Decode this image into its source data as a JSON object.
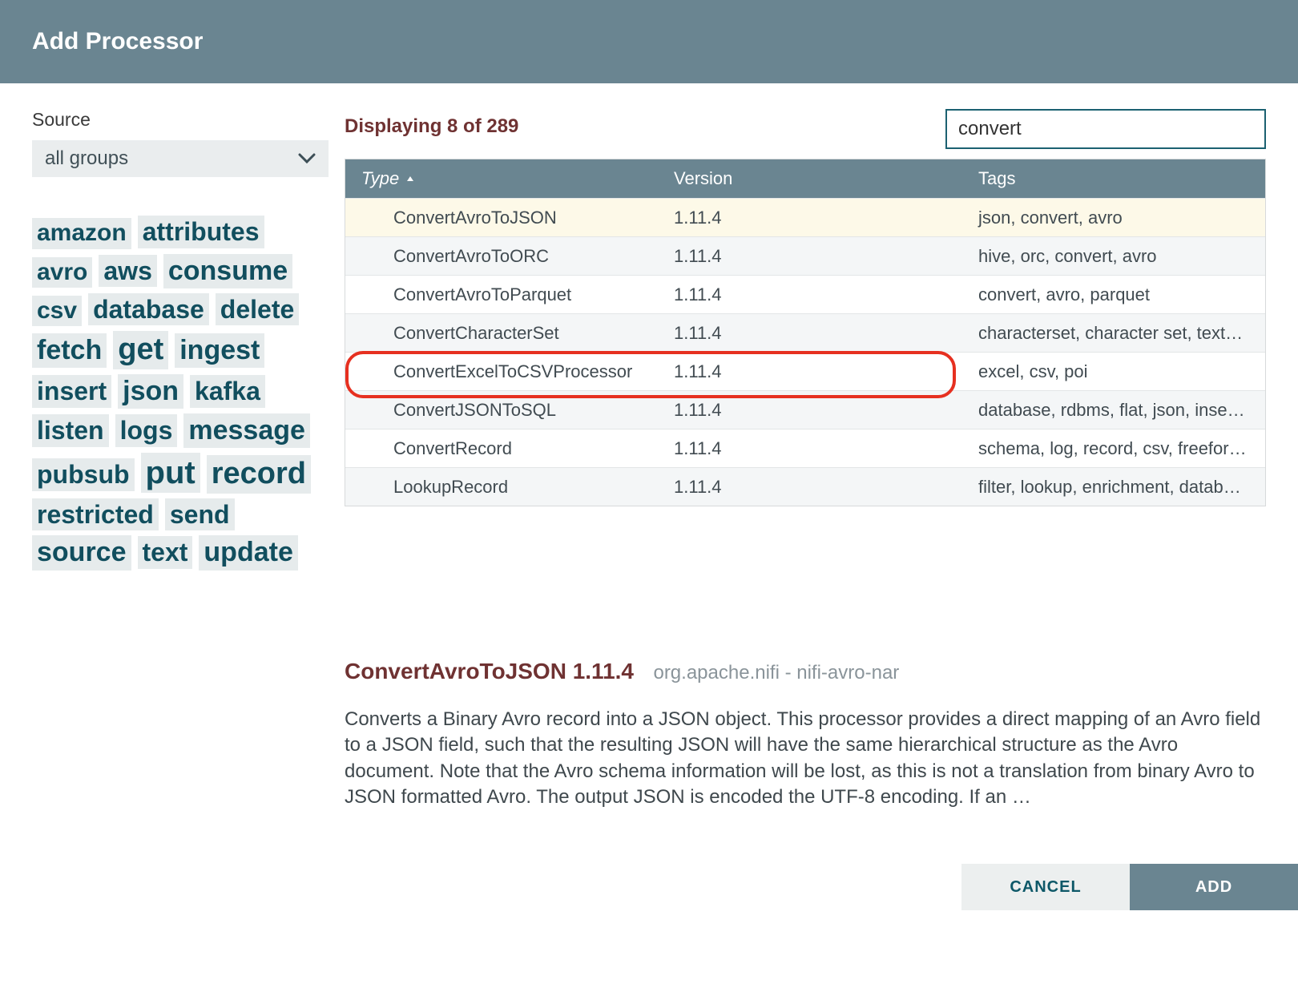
{
  "dialog": {
    "title": "Add Processor"
  },
  "source": {
    "label": "Source",
    "selected": "all groups"
  },
  "tagcloud": [
    {
      "label": "amazon",
      "size": 30
    },
    {
      "label": "attributes",
      "size": 32
    },
    {
      "label": "avro",
      "size": 30
    },
    {
      "label": "aws",
      "size": 32
    },
    {
      "label": "consume",
      "size": 34
    },
    {
      "label": "csv",
      "size": 30
    },
    {
      "label": "database",
      "size": 32
    },
    {
      "label": "delete",
      "size": 32
    },
    {
      "label": "fetch",
      "size": 34
    },
    {
      "label": "get",
      "size": 38
    },
    {
      "label": "ingest",
      "size": 34
    },
    {
      "label": "insert",
      "size": 32
    },
    {
      "label": "json",
      "size": 34
    },
    {
      "label": "kafka",
      "size": 32
    },
    {
      "label": "listen",
      "size": 32
    },
    {
      "label": "logs",
      "size": 32
    },
    {
      "label": "message",
      "size": 34
    },
    {
      "label": "pubsub",
      "size": 32
    },
    {
      "label": "put",
      "size": 40
    },
    {
      "label": "record",
      "size": 38
    },
    {
      "label": "restricted",
      "size": 32
    },
    {
      "label": "send",
      "size": 32
    },
    {
      "label": "source",
      "size": 34
    },
    {
      "label": "text",
      "size": 32
    },
    {
      "label": "update",
      "size": 34
    }
  ],
  "filter": {
    "value": "convert",
    "displaying": "Displaying 8 of 289"
  },
  "table": {
    "headers": {
      "type": "Type",
      "version": "Version",
      "tags": "Tags"
    },
    "rows": [
      {
        "type": "ConvertAvroToJSON",
        "version": "1.11.4",
        "tags": "json, convert, avro",
        "selected": true
      },
      {
        "type": "ConvertAvroToORC",
        "version": "1.11.4",
        "tags": "hive, orc, convert, avro"
      },
      {
        "type": "ConvertAvroToParquet",
        "version": "1.11.4",
        "tags": "convert, avro, parquet"
      },
      {
        "type": "ConvertCharacterSet",
        "version": "1.11.4",
        "tags": "characterset, character set, text…"
      },
      {
        "type": "ConvertExcelToCSVProcessor",
        "version": "1.11.4",
        "tags": "excel, csv, poi",
        "highlighted": true
      },
      {
        "type": "ConvertJSONToSQL",
        "version": "1.11.4",
        "tags": "database, rdbms, flat, json, inse…"
      },
      {
        "type": "ConvertRecord",
        "version": "1.11.4",
        "tags": "schema, log, record, csv, freefor…"
      },
      {
        "type": "LookupRecord",
        "version": "1.11.4",
        "tags": "filter, lookup, enrichment, datab…"
      }
    ]
  },
  "detail": {
    "title": "ConvertAvroToJSON 1.11.4",
    "meta": "org.apache.nifi - nifi-avro-nar",
    "description": "Converts a Binary Avro record into a JSON object. This processor provides a direct mapping of an Avro field to a JSON field, such that the resulting JSON will have the same hierarchical structure as the Avro document. Note that the Avro schema information will be lost, as this is not a translation from binary Avro to JSON formatted Avro. The output JSON is encoded the UTF-8 encoding. If an …"
  },
  "footer": {
    "cancel": "CANCEL",
    "add": "ADD"
  }
}
